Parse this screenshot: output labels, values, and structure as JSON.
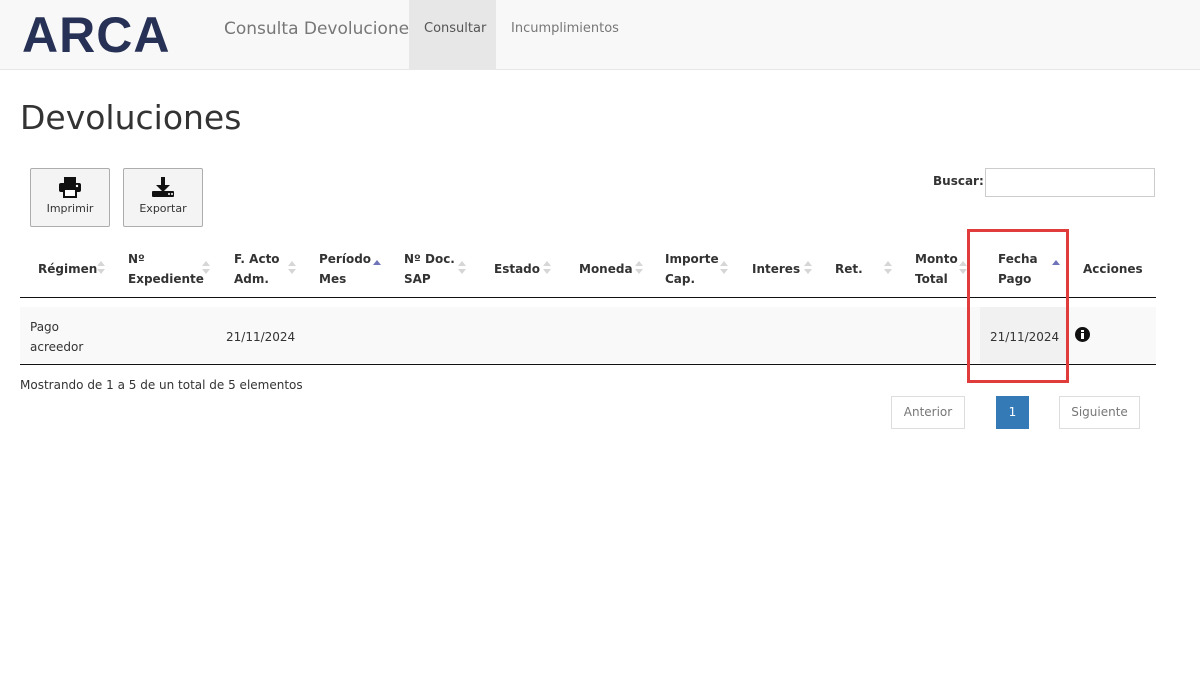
{
  "navbar": {
    "logo": "ARCA",
    "brand": "Consulta Devoluciones",
    "items": [
      {
        "label": "Consultar",
        "active": true
      },
      {
        "label": "Incumplimientos",
        "active": false
      }
    ]
  },
  "page": {
    "title": "Devoluciones"
  },
  "toolbar": {
    "print_label": "Imprimir",
    "export_label": "Exportar"
  },
  "search": {
    "label": "Buscar:",
    "value": ""
  },
  "table": {
    "columns": [
      {
        "line1": "Régimen",
        "line2": "",
        "sort": "none"
      },
      {
        "line1": "Nº",
        "line2": "Expediente",
        "sort": "none"
      },
      {
        "line1": "F. Acto",
        "line2": "Adm.",
        "sort": "none"
      },
      {
        "line1": "Período",
        "line2": "Mes",
        "sort": "asc"
      },
      {
        "line1": "Nº Doc.",
        "line2": "SAP",
        "sort": "none"
      },
      {
        "line1": "Estado",
        "line2": "",
        "sort": "none"
      },
      {
        "line1": "Moneda",
        "line2": "",
        "sort": "none"
      },
      {
        "line1": "Importe",
        "line2": "Cap.",
        "sort": "none"
      },
      {
        "line1": "Interes",
        "line2": "",
        "sort": "none"
      },
      {
        "line1": "Ret.",
        "line2": "",
        "sort": "none"
      },
      {
        "line1": "Monto",
        "line2": "Total",
        "sort": "none"
      },
      {
        "line1": "Fecha",
        "line2": "Pago",
        "sort": "asc"
      },
      {
        "line1": "Acciones",
        "line2": "",
        "sort": "none"
      }
    ],
    "rows": [
      {
        "regimen_line1": "Pago",
        "regimen_line2": "acreedor",
        "fecha_acto": "21/11/2024",
        "fecha_pago": "21/11/2024",
        "action_icon": "info-circle-icon"
      }
    ]
  },
  "footer": {
    "info": "Mostrando de 1 a 5 de un total de 5 elementos",
    "pagination": {
      "previous": "Anterior",
      "current": "1",
      "next": "Siguiente"
    }
  },
  "colors": {
    "brand": "#263155",
    "highlight": "#e03c3c",
    "pagination_active": "#337ab7"
  }
}
